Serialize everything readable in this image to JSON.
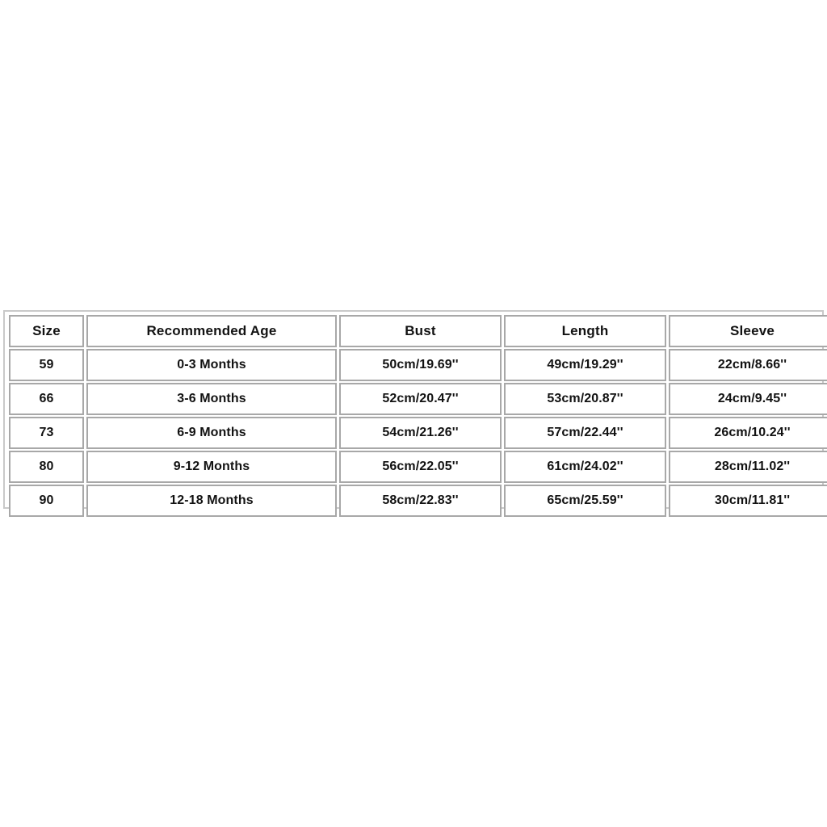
{
  "table": {
    "name": "baby-clothing-size-chart",
    "columns": [
      {
        "key": "size",
        "label": "Size"
      },
      {
        "key": "age",
        "label": "Recommended Age"
      },
      {
        "key": "bust",
        "label": "Bust"
      },
      {
        "key": "length",
        "label": "Length"
      },
      {
        "key": "sleeve",
        "label": "Sleeve"
      }
    ],
    "rows": [
      {
        "size": "59",
        "age": "0-3 Months",
        "bust": "50cm/19.69''",
        "length": "49cm/19.29''",
        "sleeve": "22cm/8.66''"
      },
      {
        "size": "66",
        "age": "3-6 Months",
        "bust": "52cm/20.47''",
        "length": "53cm/20.87''",
        "sleeve": "24cm/9.45''"
      },
      {
        "size": "73",
        "age": "6-9 Months",
        "bust": "54cm/21.26''",
        "length": "57cm/22.44''",
        "sleeve": "26cm/10.24''"
      },
      {
        "size": "80",
        "age": "9-12 Months",
        "bust": "56cm/22.05''",
        "length": "61cm/24.02''",
        "sleeve": "28cm/11.02''"
      },
      {
        "size": "90",
        "age": "12-18 Months",
        "bust": "58cm/22.83''",
        "length": "65cm/25.59''",
        "sleeve": "30cm/11.81''"
      }
    ]
  },
  "colors": {
    "page_background": "#ffffff",
    "cell_background": "#ffffff",
    "cell_border": "#a8a8a8",
    "outer_border": "#c9c9c9",
    "text": "#121212"
  }
}
